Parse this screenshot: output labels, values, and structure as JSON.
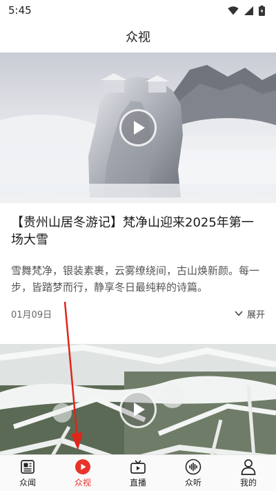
{
  "status_bar": {
    "time": "5:45",
    "icons": [
      "wifi-icon",
      "cellular-signal-icon",
      "battery-icon"
    ]
  },
  "header": {
    "title": "众视"
  },
  "articles": [
    {
      "title": "【贵州山居冬游记】梵净山迎来2025年第一场大雪",
      "summary": "雪舞梵净，银装素裹，云雾缭绕间，古山焕新颜。每一步，皆踏梦而行，静享冬日最纯粹的诗篇。",
      "date": "01月09日",
      "expand_label": "展开",
      "image": "snowy-mountain-peak-with-temple",
      "media_type": "video"
    },
    {
      "image": "snow-covered-tree-branches",
      "media_type": "video"
    }
  ],
  "bottom_nav": {
    "items": [
      {
        "label": "众闻",
        "icon": "news-icon",
        "active": false
      },
      {
        "label": "众视",
        "icon": "play-icon",
        "active": true
      },
      {
        "label": "直播",
        "icon": "tv-icon",
        "active": false
      },
      {
        "label": "众听",
        "icon": "audio-wave-icon",
        "active": false
      },
      {
        "label": "我的",
        "icon": "user-icon",
        "active": false
      }
    ]
  },
  "colors": {
    "accent": "#e8332a",
    "annotation_arrow": "#e0251b"
  }
}
